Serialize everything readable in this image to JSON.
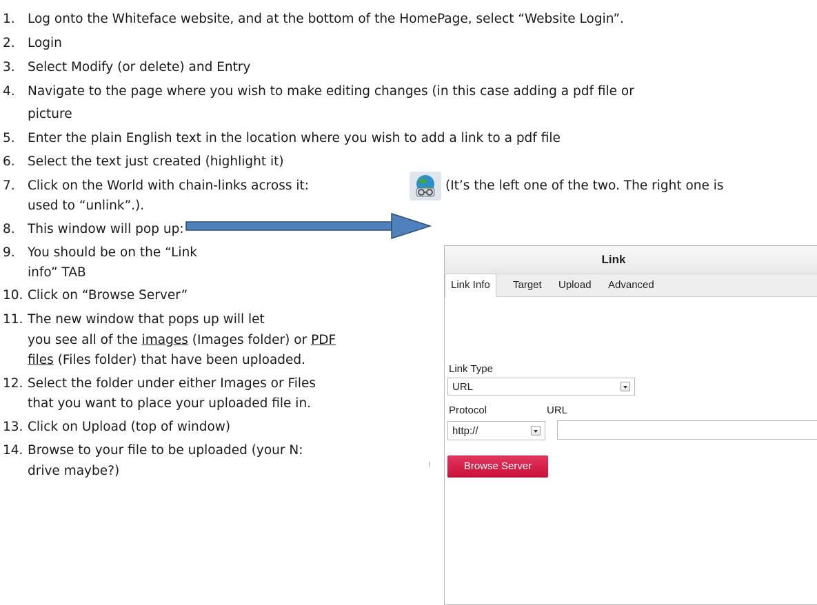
{
  "steps": [
    {
      "num": "1.",
      "text": "Log onto the Whiteface website, and at the bottom of the HomePage, select “Website Login”."
    },
    {
      "num": "2.",
      "text": "Login"
    },
    {
      "num": "3.",
      "text": "Select Modify (or delete) and Entry"
    },
    {
      "num": "4.",
      "text": "Navigate to the page where you wish to make editing changes (in this case adding a pdf file or",
      "cont": "picture"
    },
    {
      "num": "5.",
      "text": "Enter the plain English text in the location where you wish to add a link to a pdf file"
    },
    {
      "num": "6.",
      "text": "Select the text just created (highlight it)"
    },
    {
      "num": "7.",
      "text_a": "Click on the World with chain-links across it:",
      "text_b": "(It’s the left one of the two. The right one is",
      "cont": "used to “unlink”.)."
    },
    {
      "num": "8.",
      "text": "This window will pop up:"
    },
    {
      "num": "9.",
      "text": "You should be on the “Link",
      "cont": "info” TAB"
    },
    {
      "num": "10.",
      "text": "Click on “Browse Server”"
    },
    {
      "num": "11.",
      "text": "The new window that pops up will let",
      "cont1": "you see all of the",
      "link1": "images",
      "cont2": "(Images folder) or",
      "link2": "PDF",
      "cont3_link": "files",
      "cont3": "(Files folder) that have been uploaded."
    },
    {
      "num": "12.",
      "text": "Select the folder under either Images or Files",
      "cont": "that you want to place your uploaded file in."
    },
    {
      "num": "13.",
      "text": "Click on Upload (top of window)"
    },
    {
      "num": "14.",
      "text": "Browse to your file to be uploaded (your N:",
      "cont": "drive maybe?)"
    }
  ],
  "icons": {
    "link": "globe-chain-link-icon",
    "arrow": "right-arrow-icon"
  },
  "colors": {
    "arrow": "#4f81bd",
    "browse_button": "#d61a45"
  },
  "dialog": {
    "title": "Link",
    "tabs": [
      "Link Info",
      "Target",
      "Upload",
      "Advanced"
    ],
    "active_tab": "Link Info",
    "link_type_label": "Link Type",
    "link_type_value": "URL",
    "protocol_label": "Protocol",
    "protocol_value": "http://",
    "url_label": "URL",
    "url_value": "",
    "browse_button": "Browse Server"
  }
}
